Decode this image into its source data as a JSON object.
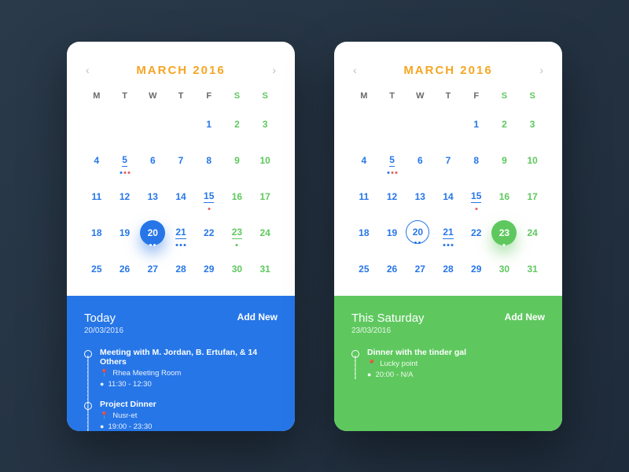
{
  "calendars": [
    {
      "month": "MARCH 2016",
      "footer_color": "blue",
      "day_label": "Today",
      "date_sub": "20/03/2016",
      "add_new": "Add New",
      "selected": 20,
      "selected_style": "filled-blue",
      "events": [
        {
          "title": "Meeting with M. Jordan, B. Ertufan, & 14 Others",
          "location": "Rhea Meeting Room",
          "time": "11:30 - 12:30"
        },
        {
          "title": "Project Dinner",
          "location": "Nusr-et",
          "time": "19:00 - 23:30"
        }
      ]
    },
    {
      "month": "MARCH 2016",
      "footer_color": "green",
      "day_label": "This Saturday",
      "date_sub": "23/03/2016",
      "add_new": "Add New",
      "selected": 23,
      "selected_style": "filled-green",
      "ringed": 20,
      "events": [
        {
          "title": "Dinner with the tinder gal",
          "location": "Lucky point",
          "time": "20:00 - N/A"
        }
      ]
    }
  ],
  "days_of_week": [
    "M",
    "T",
    "W",
    "T",
    "F",
    "S",
    "S"
  ],
  "colors": {
    "accent_orange": "#f5a623",
    "blue": "#2676e8",
    "green": "#5ec85e"
  },
  "calendar_grid": [
    {
      "n": "",
      "w": false
    },
    {
      "n": "",
      "w": false
    },
    {
      "n": "",
      "w": false
    },
    {
      "n": "",
      "w": false
    },
    {
      "n": "1",
      "w": false
    },
    {
      "n": "2",
      "w": true
    },
    {
      "n": "3",
      "w": true
    },
    {
      "n": "4",
      "w": false
    },
    {
      "n": "5",
      "w": false,
      "ul": true,
      "dots": [
        "b",
        "r",
        "r"
      ]
    },
    {
      "n": "6",
      "w": false
    },
    {
      "n": "7",
      "w": false
    },
    {
      "n": "8",
      "w": false
    },
    {
      "n": "9",
      "w": true
    },
    {
      "n": "10",
      "w": true
    },
    {
      "n": "11",
      "w": false
    },
    {
      "n": "12",
      "w": false
    },
    {
      "n": "13",
      "w": false
    },
    {
      "n": "14",
      "w": false
    },
    {
      "n": "15",
      "w": false,
      "ul": true,
      "dots": [
        "r"
      ]
    },
    {
      "n": "16",
      "w": true
    },
    {
      "n": "17",
      "w": true
    },
    {
      "n": "18",
      "w": false
    },
    {
      "n": "19",
      "w": false
    },
    {
      "n": "20",
      "w": false,
      "dots": [
        "b",
        "b"
      ]
    },
    {
      "n": "21",
      "w": false,
      "ul": true,
      "dots": [
        "b",
        "b",
        "b"
      ]
    },
    {
      "n": "22",
      "w": false
    },
    {
      "n": "23",
      "w": true,
      "ul": true,
      "dots": [
        "g"
      ]
    },
    {
      "n": "24",
      "w": true
    },
    {
      "n": "25",
      "w": false
    },
    {
      "n": "26",
      "w": false
    },
    {
      "n": "27",
      "w": false
    },
    {
      "n": "28",
      "w": false
    },
    {
      "n": "29",
      "w": false
    },
    {
      "n": "30",
      "w": true
    },
    {
      "n": "31",
      "w": true
    }
  ]
}
